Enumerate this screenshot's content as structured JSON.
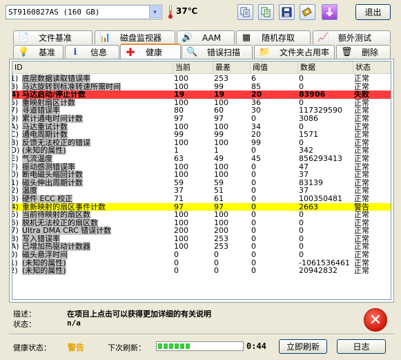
{
  "toolbar": {
    "drive": "ST9160827AS (160 GB)",
    "temperature": "37℃",
    "exit_label": "退出",
    "icons": [
      "copy-icon",
      "copy-all-icon",
      "save-icon",
      "options-icon",
      "down-icon"
    ]
  },
  "tabs_top": [
    "文件基准",
    "磁盘监视器",
    "AAM",
    "随机存取",
    "额外测试"
  ],
  "tabs_bottom": [
    "基准",
    "信息",
    "健康",
    "错误扫描",
    "文件夹占用率",
    "删除"
  ],
  "active_tab": "健康",
  "table": {
    "headers": [
      "ID",
      "当前",
      "最差",
      "阈值",
      "数据",
      "状态"
    ],
    "rows": [
      {
        "id": "01)",
        "name": "底层数据读取错误率",
        "cur": "100",
        "worst": "253",
        "thr": "6",
        "data": "0",
        "status": "正常"
      },
      {
        "id": "03)",
        "name": "马达旋转到标准转速所需时间",
        "cur": "100",
        "worst": "99",
        "thr": "85",
        "data": "0",
        "status": "正常"
      },
      {
        "id": "04)",
        "name": "马达启动/停止计数",
        "cur": "19",
        "worst": "19",
        "thr": "20",
        "data": "83906",
        "status": "失败",
        "highlight": "red"
      },
      {
        "id": "05)",
        "name": "重映射扇区计数",
        "cur": "100",
        "worst": "100",
        "thr": "36",
        "data": "0",
        "status": "正常"
      },
      {
        "id": "07)",
        "name": "寻道错误率",
        "cur": "80",
        "worst": "60",
        "thr": "30",
        "data": "117329590",
        "status": "正常"
      },
      {
        "id": "09)",
        "name": "累计通电时间计数",
        "cur": "97",
        "worst": "97",
        "thr": "0",
        "data": "3086",
        "status": "正常"
      },
      {
        "id": "0A)",
        "name": "马达重试计数",
        "cur": "100",
        "worst": "100",
        "thr": "34",
        "data": "0",
        "status": "正常"
      },
      {
        "id": "0C)",
        "name": "通电周期计数",
        "cur": "99",
        "worst": "99",
        "thr": "20",
        "data": "1571",
        "status": "正常"
      },
      {
        "id": "B8)",
        "name": "反馈无法校正的错误",
        "cur": "100",
        "worst": "100",
        "thr": "99",
        "data": "0",
        "status": "正常"
      },
      {
        "id": "BD)",
        "name": "(未知的属性)",
        "cur": "1",
        "worst": "1",
        "thr": "0",
        "data": "342",
        "status": "正常"
      },
      {
        "id": "BE)",
        "name": "气流温度",
        "cur": "63",
        "worst": "49",
        "thr": "45",
        "data": "856293413",
        "status": "正常"
      },
      {
        "id": "BF)",
        "name": "振动感测错误率",
        "cur": "100",
        "worst": "100",
        "thr": "0",
        "data": "47",
        "status": "正常"
      },
      {
        "id": "C0)",
        "name": "断电磁头缩回计数",
        "cur": "100",
        "worst": "100",
        "thr": "0",
        "data": "37",
        "status": "正常"
      },
      {
        "id": "C1)",
        "name": "磁头伸出周期计数",
        "cur": "59",
        "worst": "59",
        "thr": "0",
        "data": "83139",
        "status": "正常"
      },
      {
        "id": "C2)",
        "name": "温度",
        "cur": "37",
        "worst": "51",
        "thr": "0",
        "data": "37",
        "status": "正常"
      },
      {
        "id": "C3)",
        "name": "硬件 ECC 校正",
        "cur": "71",
        "worst": "61",
        "thr": "0",
        "data": "100350481",
        "status": "正常"
      },
      {
        "id": "C4)",
        "name": "重新映射的扇区事件计数",
        "cur": "97",
        "worst": "97",
        "thr": "0",
        "data": "2663",
        "status": "警告",
        "highlight": "yellow"
      },
      {
        "id": "C5)",
        "name": "当前待映射的扇区数",
        "cur": "100",
        "worst": "100",
        "thr": "0",
        "data": "0",
        "status": "正常"
      },
      {
        "id": "C6)",
        "name": "脱机无法校正的扇区数",
        "cur": "100",
        "worst": "100",
        "thr": "0",
        "data": "0",
        "status": "正常"
      },
      {
        "id": "C7)",
        "name": "Ultra DMA CRC 错误计数",
        "cur": "200",
        "worst": "200",
        "thr": "0",
        "data": "0",
        "status": "正常"
      },
      {
        "id": "C8)",
        "name": "写入错误率",
        "cur": "100",
        "worst": "253",
        "thr": "0",
        "data": "0",
        "status": "正常"
      },
      {
        "id": "CA)",
        "name": "已增加热驱动计数器",
        "cur": "100",
        "worst": "253",
        "thr": "0",
        "data": "0",
        "status": "正常"
      },
      {
        "id": "F0)",
        "name": "磁头悬浮时间",
        "cur": "0",
        "worst": "0",
        "thr": "0",
        "data": "0",
        "status": "正常"
      },
      {
        "id": "F1)",
        "name": "(未知的属性)",
        "cur": "0",
        "worst": "0",
        "thr": "0",
        "data": "-1061536461",
        "status": "正常"
      },
      {
        "id": "F2)",
        "name": "(未知的属性)",
        "cur": "0",
        "worst": "0",
        "thr": "0",
        "data": "20942832",
        "status": "正常"
      }
    ]
  },
  "description": {
    "desc_label": "描述：",
    "desc_text": "在项目上点击可以获得更加详细的有关说明",
    "status_label": "状态：",
    "status_value": "n/a"
  },
  "footer": {
    "health_label": "健康状态：",
    "health_value": "警告",
    "next_refresh_label": "下次刷新：",
    "refresh_progress": 0.4,
    "timer": "0:44",
    "refresh_button": "立即刷新",
    "log_button": "日志"
  }
}
